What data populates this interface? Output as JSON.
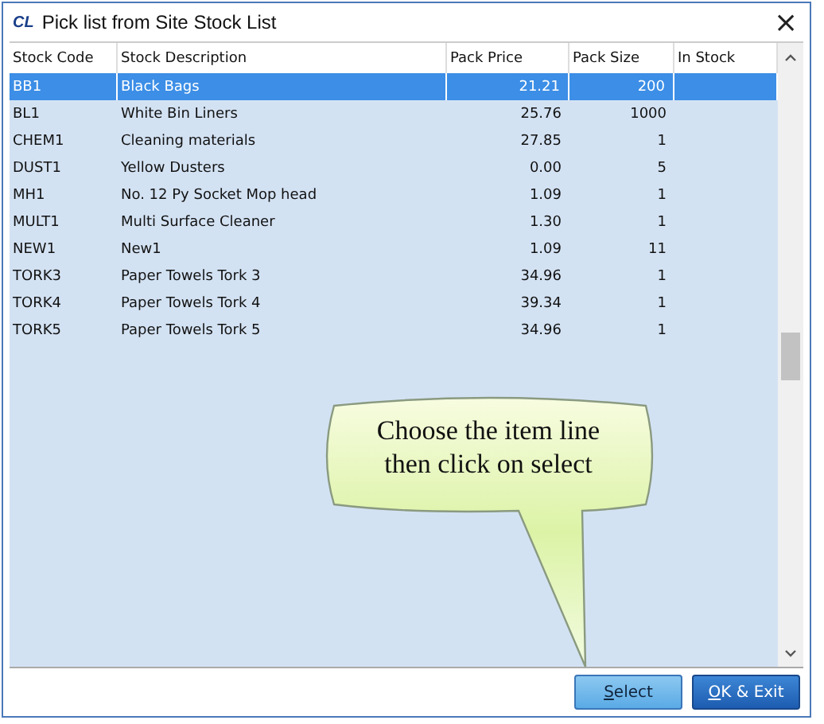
{
  "window": {
    "logo": "CL",
    "title": "Pick list from Site Stock List",
    "close": "×"
  },
  "table": {
    "columns": [
      "Stock Code",
      "Stock Description",
      "Pack Price",
      "Pack Size",
      "In Stock"
    ],
    "rows": [
      {
        "code": "BB1",
        "description": "Black Bags",
        "price": "21.21",
        "size": "200",
        "selected": true
      },
      {
        "code": "BL1",
        "description": "White Bin Liners",
        "price": "25.76",
        "size": "1000",
        "selected": false
      },
      {
        "code": "CHEM1",
        "description": "Cleaning materials",
        "price": "27.85",
        "size": "1",
        "selected": false
      },
      {
        "code": "DUST1",
        "description": "Yellow Dusters",
        "price": "0.00",
        "size": "5",
        "selected": false
      },
      {
        "code": "MH1",
        "description": "No. 12 Py Socket Mop head",
        "price": "1.09",
        "size": "1",
        "selected": false
      },
      {
        "code": "MULT1",
        "description": "Multi Surface Cleaner",
        "price": "1.30",
        "size": "1",
        "selected": false
      },
      {
        "code": "NEW1",
        "description": "New1",
        "price": "1.09",
        "size": "11",
        "selected": false
      },
      {
        "code": "TORK3",
        "description": "Paper Towels Tork 3",
        "price": "34.96",
        "size": "1",
        "selected": false
      },
      {
        "code": "TORK4",
        "description": "Paper Towels Tork 4",
        "price": "39.34",
        "size": "1",
        "selected": false
      },
      {
        "code": "TORK5",
        "description": "Paper Towels Tork 5",
        "price": "34.96",
        "size": "1",
        "selected": false
      }
    ]
  },
  "callout": {
    "lines": [
      "Choose the item line",
      "then click on select"
    ]
  },
  "buttons": [
    {
      "label": "Select",
      "kind": "secondary"
    },
    {
      "label": "OK & Exit",
      "kind": "primary"
    }
  ]
}
